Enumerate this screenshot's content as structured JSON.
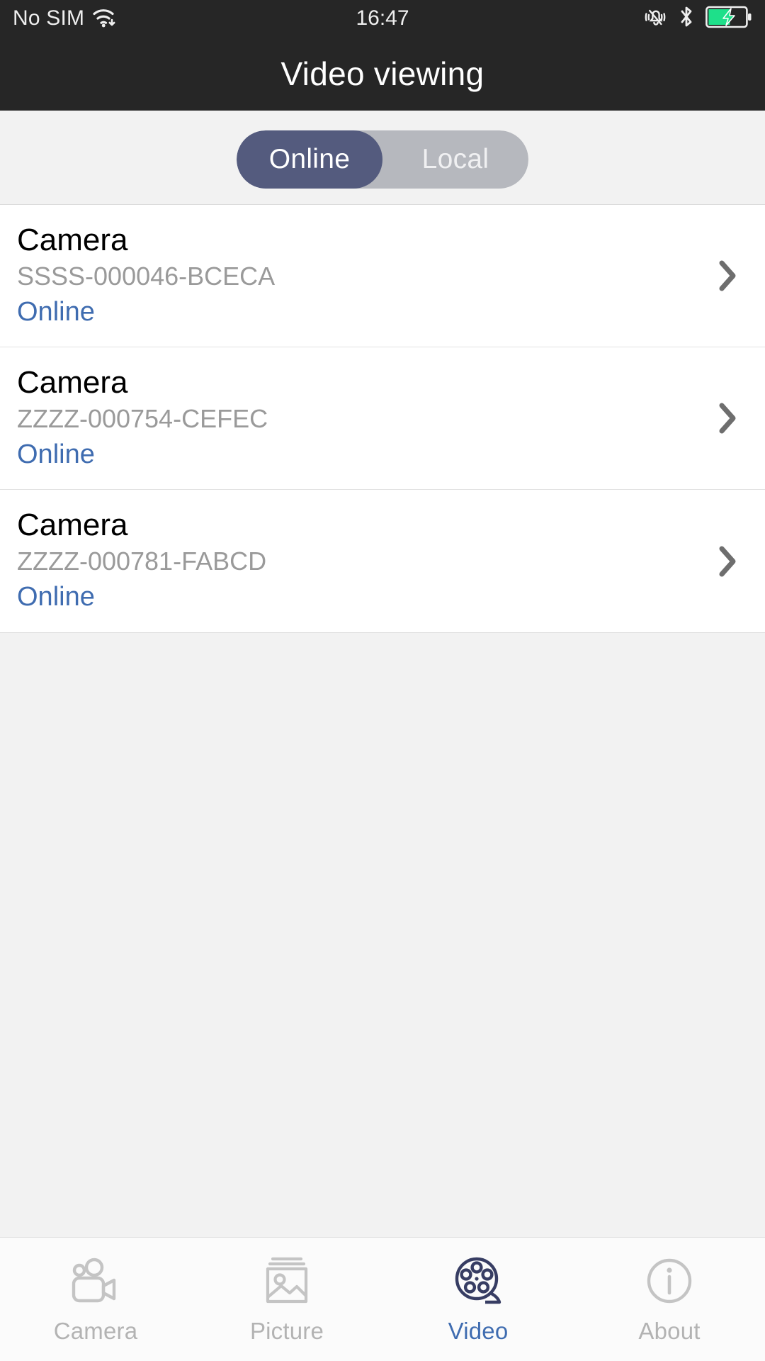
{
  "statusbar": {
    "carrier": "No SIM",
    "time": "16:47",
    "icons": {
      "wifi": "wifi-icon",
      "silent": "bell-muted-icon",
      "bluetooth": "bluetooth-icon",
      "battery": "battery-charging-icon"
    }
  },
  "header": {
    "title": "Video viewing"
  },
  "segment": {
    "options": [
      {
        "label": "Online",
        "active": true
      },
      {
        "label": "Local",
        "active": false
      }
    ],
    "active_color": "#545b7e",
    "inactive_color": "#b6b8be"
  },
  "list": {
    "items": [
      {
        "name": "Camera",
        "id": "SSSS-000046-BCECA",
        "status": "Online"
      },
      {
        "name": "Camera",
        "id": "ZZZZ-000754-CEFEC",
        "status": "Online"
      },
      {
        "name": "Camera",
        "id": "ZZZZ-000781-FABCD",
        "status": "Online"
      }
    ],
    "status_color": "#3f6cb0",
    "id_color": "#9a9a9a",
    "chevron": "chevron-right-icon"
  },
  "tabbar": {
    "tabs": [
      {
        "label": "Camera",
        "icon": "camcorder-icon",
        "active": false
      },
      {
        "label": "Picture",
        "icon": "image-icon",
        "active": false
      },
      {
        "label": "Video",
        "icon": "film-reel-icon",
        "active": true
      },
      {
        "label": "About",
        "icon": "info-circle-icon",
        "active": false
      }
    ],
    "active_label_color": "#3f6cb0",
    "active_icon_color": "#373d63",
    "inactive_color": "#bfbfbf"
  }
}
